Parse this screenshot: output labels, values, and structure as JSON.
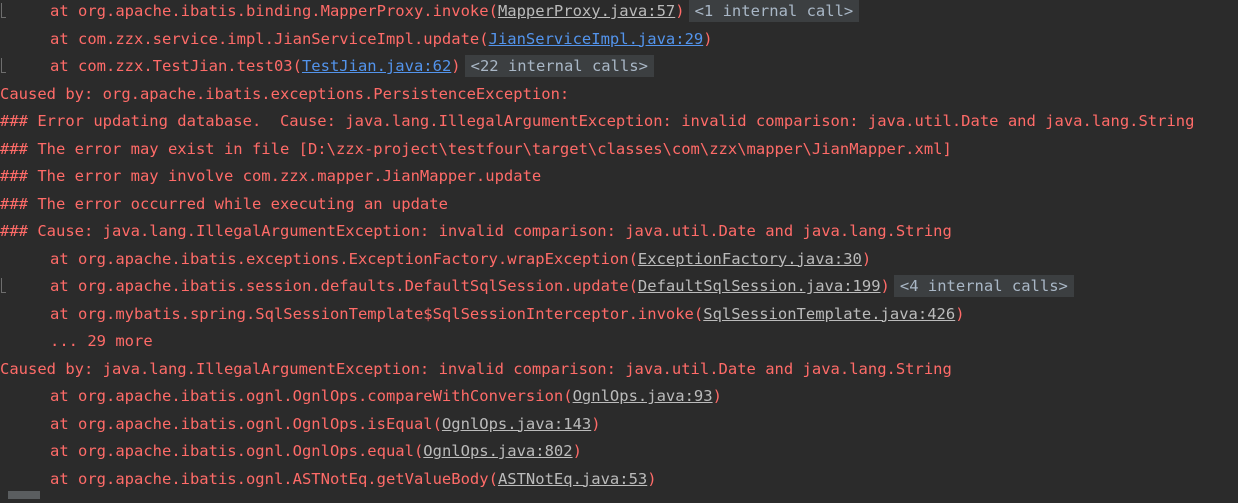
{
  "console": {
    "lines": [
      {
        "type": "frame",
        "text": "at org.apache.ibatis.binding.MapperProxy.invoke(",
        "link": "MapperProxy.java:57",
        "close": ")",
        "internal": "<1 internal call>",
        "fold": true
      },
      {
        "type": "frame",
        "text": "at com.zzx.service.impl.JianServiceImpl.update(",
        "link": "JianServiceImpl.java:29",
        "close": ")",
        "blue": true
      },
      {
        "type": "frame",
        "text": "at com.zzx.TestJian.test03(",
        "link": "TestJian.java:62",
        "close": ")",
        "internal": "<22 internal calls>",
        "fold": true,
        "blue": true
      },
      {
        "type": "plain",
        "text": "Caused by: org.apache.ibatis.exceptions.PersistenceException:"
      },
      {
        "type": "plain",
        "text": "### Error updating database.  Cause: java.lang.IllegalArgumentException: invalid comparison: java.util.Date and java.lang.String"
      },
      {
        "type": "plain",
        "text": "### The error may exist in file [D:\\zzx-project\\testfour\\target\\classes\\com\\zzx\\mapper\\JianMapper.xml]"
      },
      {
        "type": "plain",
        "text": "### The error may involve com.zzx.mapper.JianMapper.update"
      },
      {
        "type": "plain",
        "text": "### The error occurred while executing an update"
      },
      {
        "type": "plain",
        "text": "### Cause: java.lang.IllegalArgumentException: invalid comparison: java.util.Date and java.lang.String"
      },
      {
        "type": "frame",
        "text": "at org.apache.ibatis.exceptions.ExceptionFactory.wrapException(",
        "link": "ExceptionFactory.java:30",
        "close": ")"
      },
      {
        "type": "frame",
        "text": "at org.apache.ibatis.session.defaults.DefaultSqlSession.update(",
        "link": "DefaultSqlSession.java:199",
        "close": ")",
        "internal": "<4 internal calls>",
        "fold": true
      },
      {
        "type": "frame",
        "text": "at org.mybatis.spring.SqlSessionTemplate$SqlSessionInterceptor.invoke(",
        "link": "SqlSessionTemplate.java:426",
        "close": ")"
      },
      {
        "type": "frame",
        "text": "... 29 more"
      },
      {
        "type": "plain",
        "text": "Caused by: java.lang.IllegalArgumentException: invalid comparison: java.util.Date and java.lang.String"
      },
      {
        "type": "frame",
        "text": "at org.apache.ibatis.ognl.OgnlOps.compareWithConversion(",
        "link": "OgnlOps.java:93",
        "close": ")"
      },
      {
        "type": "frame",
        "text": "at org.apache.ibatis.ognl.OgnlOps.isEqual(",
        "link": "OgnlOps.java:143",
        "close": ")"
      },
      {
        "type": "frame",
        "text": "at org.apache.ibatis.ognl.OgnlOps.equal(",
        "link": "OgnlOps.java:802",
        "close": ")"
      },
      {
        "type": "frame",
        "text": "at org.apache.ibatis.ognl.ASTNotEq.getValueBody(",
        "link": "ASTNotEq.java:53",
        "close": ")"
      }
    ]
  },
  "colors": {
    "background": "#2b2b2b",
    "error_text": "#ff6b68",
    "link_gray": "#bbbbbb",
    "link_blue": "#5394ec",
    "internal_bg": "#3c3f41"
  }
}
